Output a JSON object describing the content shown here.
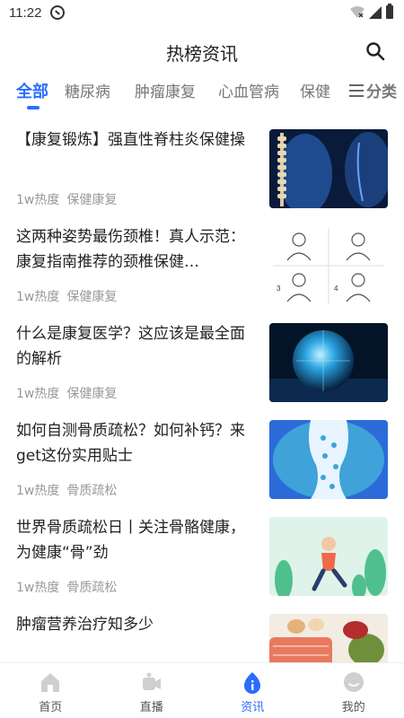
{
  "status_bar": {
    "time": "11:22"
  },
  "header": {
    "title": "热榜资讯"
  },
  "tabs": [
    {
      "label": "全部"
    },
    {
      "label": "糖尿病"
    },
    {
      "label": "肿瘤康复"
    },
    {
      "label": "心血管病"
    },
    {
      "label": "保健"
    }
  ],
  "category_label": "分类",
  "news": [
    {
      "title": "【康复锻炼】强直性脊柱炎保健操",
      "heat": "1w热度",
      "tag": "保健康复",
      "image": "spine-xray-image"
    },
    {
      "title": "这两种姿势最伤颈椎！真人示范：康复指南推荐的颈椎保健…",
      "heat": "1w热度",
      "tag": "保健康复",
      "image": "neck-exercise-image"
    },
    {
      "title": "什么是康复医学？这应该是最全面的解析",
      "heat": "1w热度",
      "tag": "保健康复",
      "image": "glass-globe-image"
    },
    {
      "title": "如何自测骨质疏松？如何补钙？来get这份实用贴士",
      "heat": "1w热度",
      "tag": "骨质疏松",
      "image": "bone-illustration-image"
    },
    {
      "title": "世界骨质疏松日丨关注骨骼健康，为健康“骨”劲",
      "heat": "1w热度",
      "tag": "骨质疏松",
      "image": "running-woman-image"
    },
    {
      "title": "肿瘤营养治疗知多少",
      "heat": "",
      "tag": "",
      "image": "food-image"
    }
  ],
  "bottom_nav": [
    {
      "label": "首页",
      "icon": "home-icon"
    },
    {
      "label": "直播",
      "icon": "live-icon"
    },
    {
      "label": "资讯",
      "icon": "news-icon"
    },
    {
      "label": "我的",
      "icon": "profile-icon"
    }
  ],
  "colors": {
    "accent": "#2b6cff",
    "text": "#222222",
    "muted": "#999999"
  }
}
